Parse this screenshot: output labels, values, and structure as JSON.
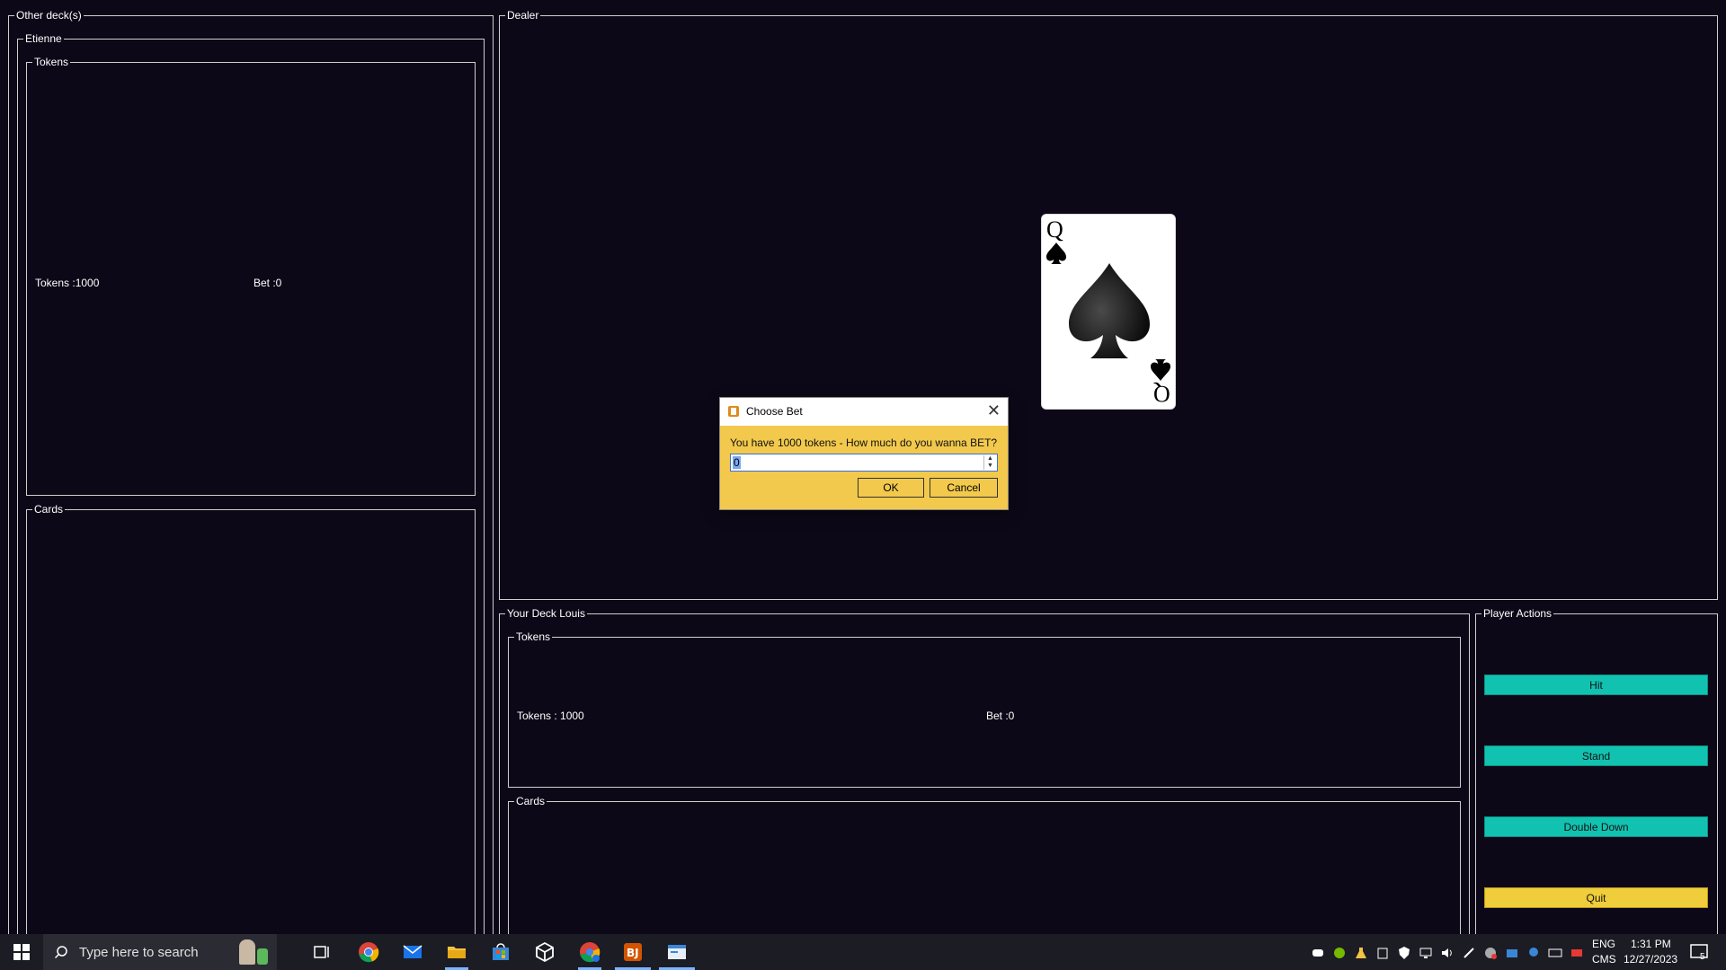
{
  "panels": {
    "other_decks": "Other deck(s)",
    "player_name": "Etienne",
    "tokens_group": "Tokens",
    "cards_group": "Cards",
    "dealer": "Dealer",
    "your_deck": "Your Deck Louis",
    "player_actions": "Player Actions"
  },
  "other_player": {
    "tokens_text": "Tokens :1000",
    "bet_text": "Bet :0"
  },
  "your_deck": {
    "tokens_text": "Tokens : 1000",
    "bet_text": "Bet :0"
  },
  "dealer_card": {
    "rank": "Q",
    "suit": "spades"
  },
  "actions": {
    "hit": "Hit",
    "stand": "Stand",
    "double_down": "Double Down",
    "quit": "Quit"
  },
  "dialog": {
    "title": "Choose Bet",
    "message": "You have  1000  tokens -  How much do you wanna BET?",
    "input_value": "0",
    "ok": "OK",
    "cancel": "Cancel"
  },
  "taskbar": {
    "search_placeholder": "Type here to search",
    "lang_top": "ENG",
    "lang_bottom": "CMS",
    "time": "1:31 PM",
    "date": "12/27/2023",
    "notifications": "5"
  },
  "colors": {
    "background": "#0d0817",
    "action_button": "#12c2b0",
    "quit_button": "#f0cd3a",
    "dialog_bg": "#f2c94c"
  }
}
